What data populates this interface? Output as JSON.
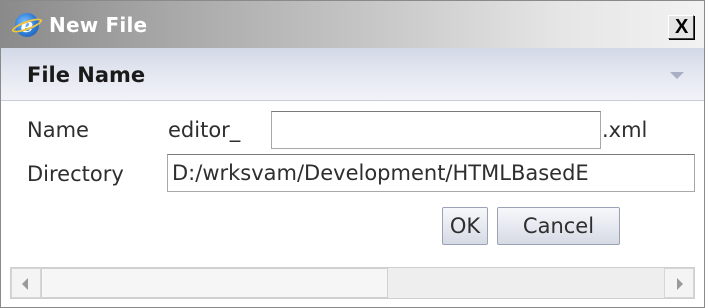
{
  "window": {
    "title": "New File",
    "close_label": "X",
    "icon": "ie-icon"
  },
  "section": {
    "title": "File Name",
    "collapse_icon": "chevron-down-icon"
  },
  "form": {
    "name_label": "Name",
    "name_prefix": "editor_",
    "name_value": "",
    "name_suffix": ".xml",
    "directory_label": "Directory",
    "directory_value": "D:/wrksvam/Development/HTMLBasedE"
  },
  "buttons": {
    "ok_label": "OK",
    "cancel_label": "Cancel"
  },
  "scrollbar": {
    "left_icon": "arrow-left-icon",
    "right_icon": "arrow-right-icon"
  },
  "colors": {
    "section_header": "#dde2ee",
    "title_gradient_start": "#8a8a8a"
  }
}
